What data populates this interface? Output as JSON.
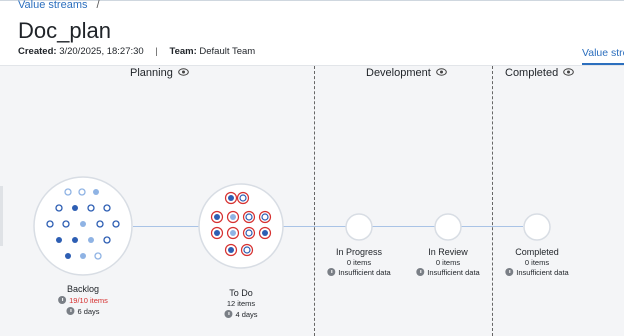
{
  "breadcrumb": {
    "link": "Value streams",
    "separator": "/"
  },
  "page": {
    "title": "Doc_plan"
  },
  "meta": {
    "created_label": "Created:",
    "created_value": "3/20/2025, 18:27:30",
    "separator": "|",
    "team_label": "Team:",
    "team_value": "Default Team"
  },
  "tabs": {
    "active": "Value strea"
  },
  "stages": [
    {
      "name": "Planning",
      "icon": "eye-icon"
    },
    {
      "name": "Development",
      "icon": "eye-icon"
    },
    {
      "name": "Completed",
      "icon": "eye-icon"
    }
  ],
  "nodes": {
    "backlog": {
      "label": "Backlog",
      "items": "19/10 items",
      "duration": "6 days"
    },
    "todo": {
      "label": "To Do",
      "items": "12 items",
      "duration": "4 days"
    },
    "in_progress": {
      "label": "In Progress",
      "items": "0 items",
      "duration": "Insufficient data"
    },
    "in_review": {
      "label": "In Review",
      "items": "0 items",
      "duration": "Insufficient data"
    },
    "completed": {
      "label": "Completed",
      "items": "0 items",
      "duration": "Insufficient data"
    }
  },
  "colors": {
    "accent": "#2c6fbe",
    "dot_dark": "#2d5eb3",
    "dot_light": "#8fb3e4",
    "over_limit": "#d6302f",
    "flow_line": "#a9c3e6"
  }
}
